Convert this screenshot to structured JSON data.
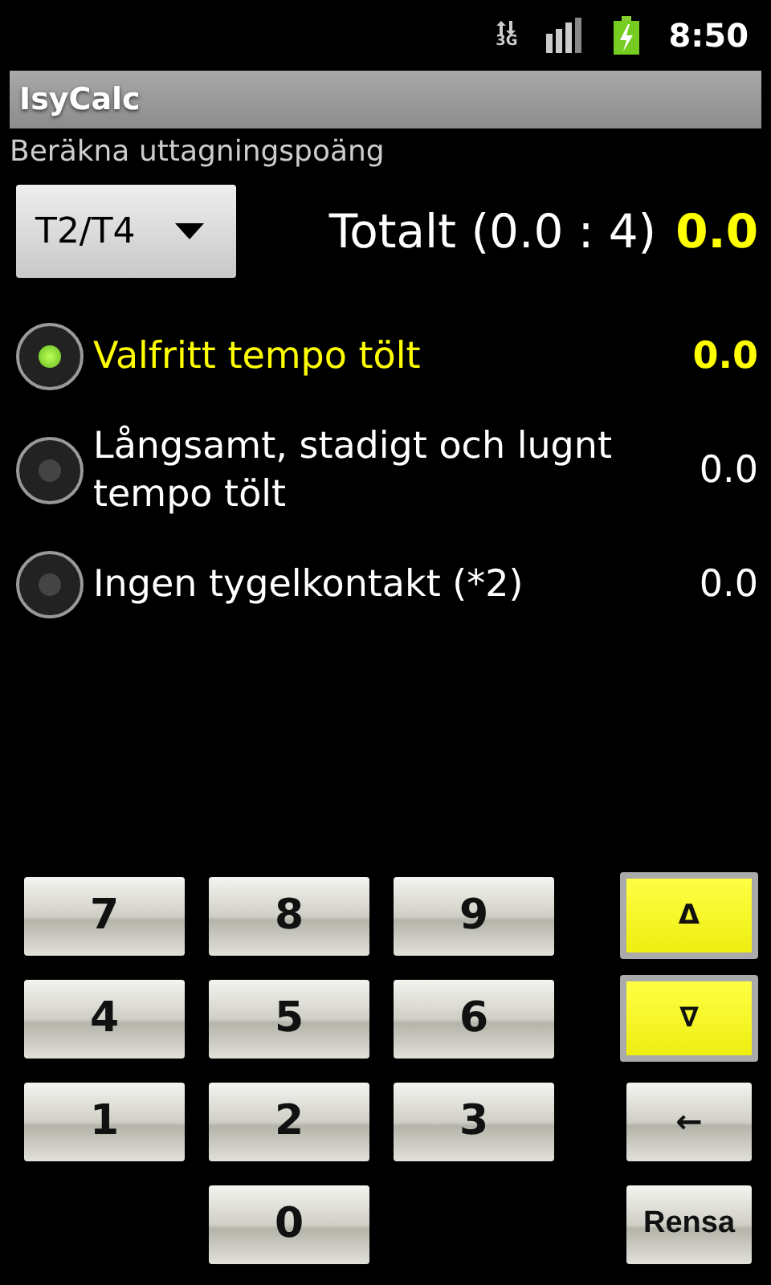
{
  "status_bar": {
    "network": "3G",
    "time": "8:50"
  },
  "window": {
    "title": "IsyCalc"
  },
  "subtitle": "Beräkna uttagningspoäng",
  "class_spinner": {
    "value": "T2/T4"
  },
  "total": {
    "label": "Totalt (0.0 : 4)",
    "value": "0.0"
  },
  "options": [
    {
      "label": "Valfritt tempo tölt",
      "value": "0.0",
      "selected": true
    },
    {
      "label": "Långsamt, stadigt och lugnt tempo tölt",
      "value": "0.0",
      "selected": false
    },
    {
      "label": "Ingen tygelkontakt (*2)",
      "value": "0.0",
      "selected": false
    }
  ],
  "keypad": {
    "rows": [
      {
        "keys": [
          "7",
          "8",
          "9"
        ],
        "side": {
          "label": "Δ",
          "highlighted": true
        }
      },
      {
        "keys": [
          "4",
          "5",
          "6"
        ],
        "side": {
          "label": "∇",
          "highlighted": true
        }
      },
      {
        "keys": [
          "1",
          "2",
          "3"
        ],
        "side": {
          "label": "←",
          "highlighted": false
        }
      },
      {
        "keys": [
          "0"
        ],
        "side": {
          "label": "Rensa",
          "highlighted": false
        }
      }
    ]
  }
}
